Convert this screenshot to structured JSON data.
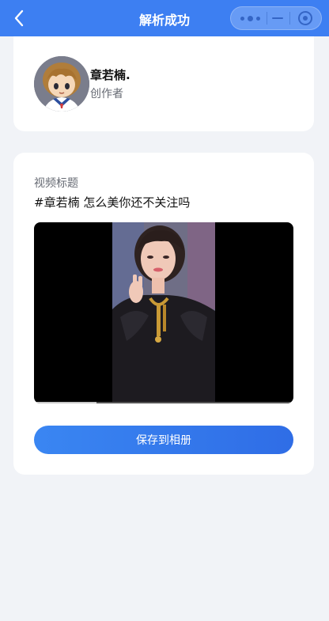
{
  "navbar": {
    "title": "解析成功",
    "back_icon": "chevron-left-icon",
    "capsule_icons": [
      "more-dots-icon",
      "minimize-icon",
      "target-icon"
    ],
    "background_color": "#3d7ff2"
  },
  "author": {
    "name": "章若楠.",
    "role": "创作者",
    "avatar_icon": "avatar-image"
  },
  "video": {
    "label": "视频标题",
    "title": "#章若楠 怎么美你还不关注吗",
    "progress": 0.24
  },
  "actions": {
    "save_label": "保存到相册"
  }
}
